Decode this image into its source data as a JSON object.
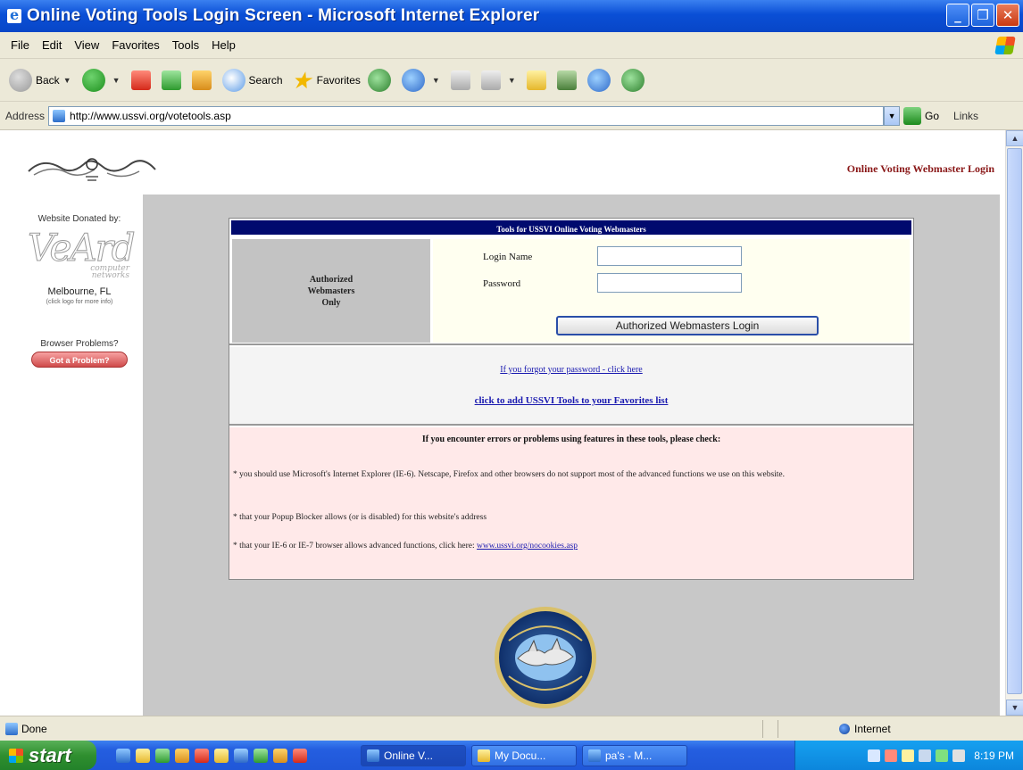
{
  "window": {
    "title": "Online Voting Tools Login Screen - Microsoft Internet Explorer",
    "minimize": "_",
    "maximize": "❐",
    "close": "✕"
  },
  "menu": [
    "File",
    "Edit",
    "View",
    "Favorites",
    "Tools",
    "Help"
  ],
  "toolbar": {
    "back": "Back",
    "search": "Search",
    "favorites": "Favorites"
  },
  "address": {
    "label": "Address",
    "url": "http://www.ussvi.org/votetools.asp",
    "go": "Go",
    "links": "Links"
  },
  "page": {
    "header_link": "Online Voting Webmaster Login",
    "sidebar": {
      "donated_by": "Website Donated by:",
      "logo_text": "VeArd",
      "logo_sub1": "computer",
      "logo_sub2": "networks",
      "city": "Melbourne, FL",
      "city_info": "(click logo for more info)",
      "browser_problems": "Browser Problems?",
      "problem_button": "Got a Problem?"
    },
    "panel": {
      "heading": "Tools for USSVI Online Voting Webmasters",
      "auth_line1": "Authorized",
      "auth_line2": "Webmasters",
      "auth_line3": "Only",
      "login_label": "Login Name",
      "password_label": "Password",
      "login_value": "",
      "password_value": "",
      "login_button": "Authorized Webmasters Login",
      "forgot_link": "If you forgot your password - click here",
      "favorites_link": "click to add USSVI Tools to your Favorites list",
      "errors_title": "If you encounter errors or problems using features in these tools, please check:",
      "error1": "* you should use Microsoft's Internet Explorer (IE-6).  Netscape, Firefox and other browsers do not support most of the advanced functions we use on this website.",
      "error2": "* that your Popup Blocker allows (or is disabled) for this website's address",
      "error3_prefix": "* that your IE-6 or IE-7 browser allows advanced functions, click here: ",
      "error3_link": "www.ussvi.org/nocookies.asp"
    }
  },
  "status": {
    "text": "Done",
    "zone": "Internet"
  },
  "taskbar": {
    "start": "start",
    "tasks": [
      "Online V...",
      "My Docu...",
      "pa's - M..."
    ],
    "clock": "8:19 PM"
  }
}
